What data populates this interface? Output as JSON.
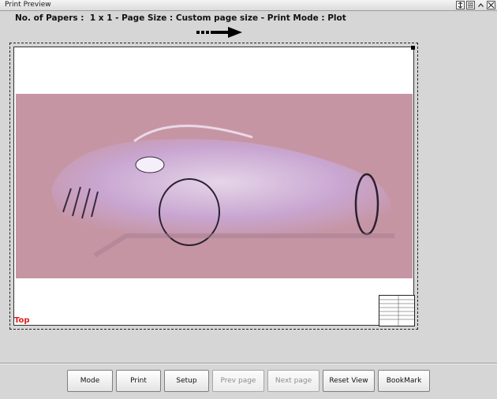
{
  "window": {
    "title": "Print Preview",
    "controls": [
      "pin-icon",
      "menu-icon",
      "minimize-icon",
      "close-icon"
    ]
  },
  "info": {
    "line": "No. of Papers :  1 x 1 - Page Size : Custom page size - Print Mode : Plot"
  },
  "preview": {
    "orientation_label": "Top",
    "art_color": "#c695a4",
    "art_alt": "car sketch"
  },
  "toolbar": {
    "mode": "Mode",
    "print": "Print",
    "setup": "Setup",
    "prev_page": "Prev page",
    "next_page": "Next page",
    "reset_view": "Reset View",
    "bookmark": "BookMark"
  },
  "colors": {
    "top_label": "#e02020",
    "background": "#d6d6d6"
  }
}
